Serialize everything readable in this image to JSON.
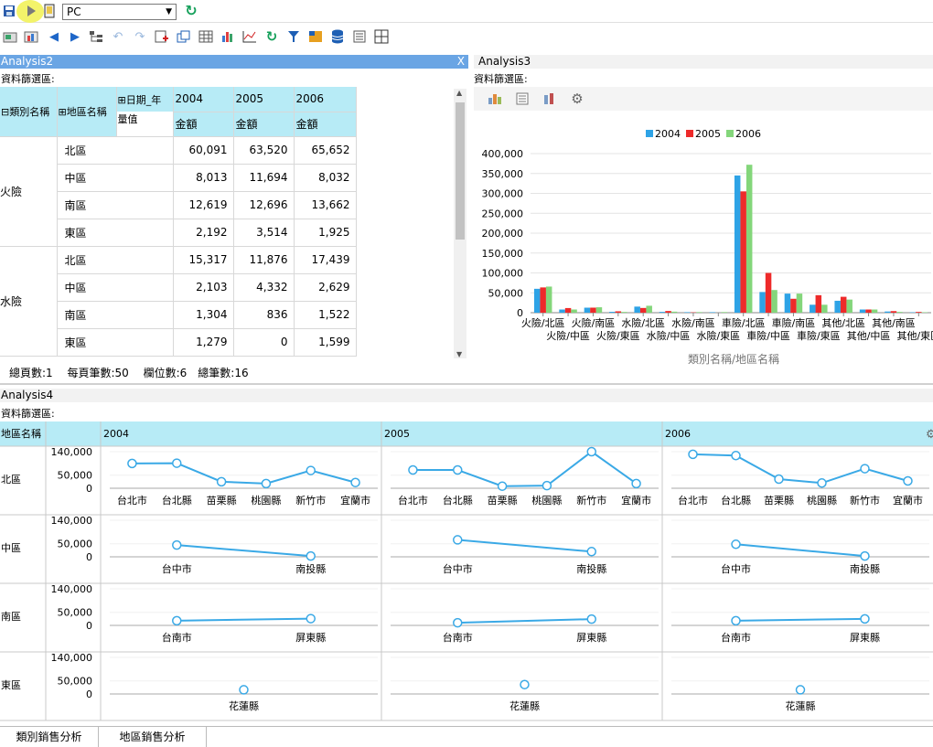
{
  "toolbar": {
    "device_value": "PC",
    "icons1": [
      "save-icon",
      "run-icon",
      "device-icon"
    ],
    "icons2": [
      "open-icon",
      "chart-image-icon",
      "back-icon",
      "forward-icon",
      "tree-icon",
      "undo-icon",
      "redo-icon",
      "add-icon",
      "copy-icon",
      "table-icon",
      "bar-chart-icon",
      "line-chart-icon",
      "refresh-icon",
      "filter-icon",
      "pivot-icon",
      "database-icon",
      "list-icon",
      "grid-icon"
    ]
  },
  "analysis2": {
    "title": "Analysis2",
    "close": "X",
    "filter_label": "資料篩選區:",
    "col_dim1": "類別名稱",
    "col_dim2": "地區名稱",
    "date_dim": "日期_年",
    "measure_label": "量值",
    "years": [
      "2004",
      "2005",
      "2006"
    ],
    "measure": "金額",
    "groups": [
      {
        "name": "火險",
        "rows": [
          {
            "region": "北區",
            "v": [
              "60,091",
              "63,520",
              "65,652"
            ]
          },
          {
            "region": "中區",
            "v": [
              "8,013",
              "11,694",
              "8,032"
            ]
          },
          {
            "region": "南區",
            "v": [
              "12,619",
              "12,696",
              "13,662"
            ]
          },
          {
            "region": "東區",
            "v": [
              "2,192",
              "3,514",
              "1,925"
            ]
          }
        ]
      },
      {
        "name": "水險",
        "rows": [
          {
            "region": "北區",
            "v": [
              "15,317",
              "11,876",
              "17,439"
            ]
          },
          {
            "region": "中區",
            "v": [
              "2,103",
              "4,332",
              "2,629"
            ]
          },
          {
            "region": "南區",
            "v": [
              "1,304",
              "836",
              "1,522"
            ]
          },
          {
            "region": "東區",
            "v": [
              "1,279",
              "0",
              "1,599"
            ]
          }
        ]
      }
    ],
    "status": "總頁數:1　 每頁筆數:50　 欄位數:6　總筆數:16"
  },
  "analysis3": {
    "title": "Analysis3",
    "filter_label": "資料篩選區:",
    "icons": [
      "bar-chart-icon",
      "list-icon",
      "stacked-chart-icon",
      "gear-icon"
    ]
  },
  "chart_data": {
    "type": "bar",
    "xlabel": "類別名稱/地區名稱",
    "ylim": [
      0,
      400000
    ],
    "yticks": [
      "0",
      "50,000",
      "100,000",
      "150,000",
      "200,000",
      "250,000",
      "300,000",
      "350,000",
      "400,000"
    ],
    "categories": [
      "火險/北區",
      "火險/中區",
      "火險/南區",
      "火險/東區",
      "水險/北區",
      "水險/中區",
      "水險/南區",
      "水險/東區",
      "車險/北區",
      "車險/中區",
      "車險/南區",
      "車險/東區",
      "其他/北區",
      "其他/中區",
      "其他/南區",
      "其他/東區"
    ],
    "legend_position": "top",
    "series": [
      {
        "name": "2004",
        "color": "#2ea3e6",
        "values": [
          60091,
          8013,
          12619,
          2192,
          15317,
          2103,
          1304,
          1279,
          345000,
          52000,
          48000,
          20000,
          30000,
          8000,
          3000,
          1000
        ]
      },
      {
        "name": "2005",
        "color": "#ee2a2a",
        "values": [
          63520,
          11694,
          12696,
          3514,
          11876,
          4332,
          836,
          0,
          305000,
          100000,
          35000,
          44000,
          40000,
          8000,
          4000,
          2000
        ]
      },
      {
        "name": "2006",
        "color": "#84d67b",
        "values": [
          65652,
          8032,
          13662,
          1925,
          17439,
          2629,
          1522,
          1599,
          372000,
          57000,
          48000,
          20000,
          33000,
          8000,
          2000,
          1000
        ]
      }
    ]
  },
  "analysis4": {
    "title": "Analysis4",
    "filter_label": "資料篩選區:",
    "row_header": "地區名稱",
    "years": [
      "2004",
      "2005",
      "2006"
    ],
    "yticks": [
      "140,000",
      "50,000",
      "0"
    ],
    "rows": [
      {
        "region": "北區",
        "cities": [
          "台北市",
          "台北縣",
          "苗栗縣",
          "桃園縣",
          "新竹市",
          "宜蘭市"
        ],
        "values": [
          [
            95000,
            96000,
            25000,
            18000,
            68000,
            22000
          ],
          [
            70000,
            70000,
            8000,
            10000,
            140000,
            18000
          ],
          [
            130000,
            125000,
            35000,
            20000,
            75000,
            28000
          ]
        ]
      },
      {
        "region": "中區",
        "cities": [
          "台中市",
          "南投縣"
        ],
        "values": [
          [
            45000,
            3000
          ],
          [
            65000,
            20000
          ],
          [
            48000,
            3000
          ]
        ]
      },
      {
        "region": "南區",
        "cities": [
          "台南市",
          "屏東縣"
        ],
        "values": [
          [
            18000,
            26000
          ],
          [
            10000,
            24000
          ],
          [
            18000,
            25000
          ]
        ]
      },
      {
        "region": "東區",
        "cities": [
          "花蓮縣"
        ],
        "values": [
          [
            16000
          ],
          [
            36000
          ],
          [
            16000
          ]
        ]
      }
    ]
  },
  "tabs": [
    "類別銷售分析",
    "地區銷售分析"
  ]
}
